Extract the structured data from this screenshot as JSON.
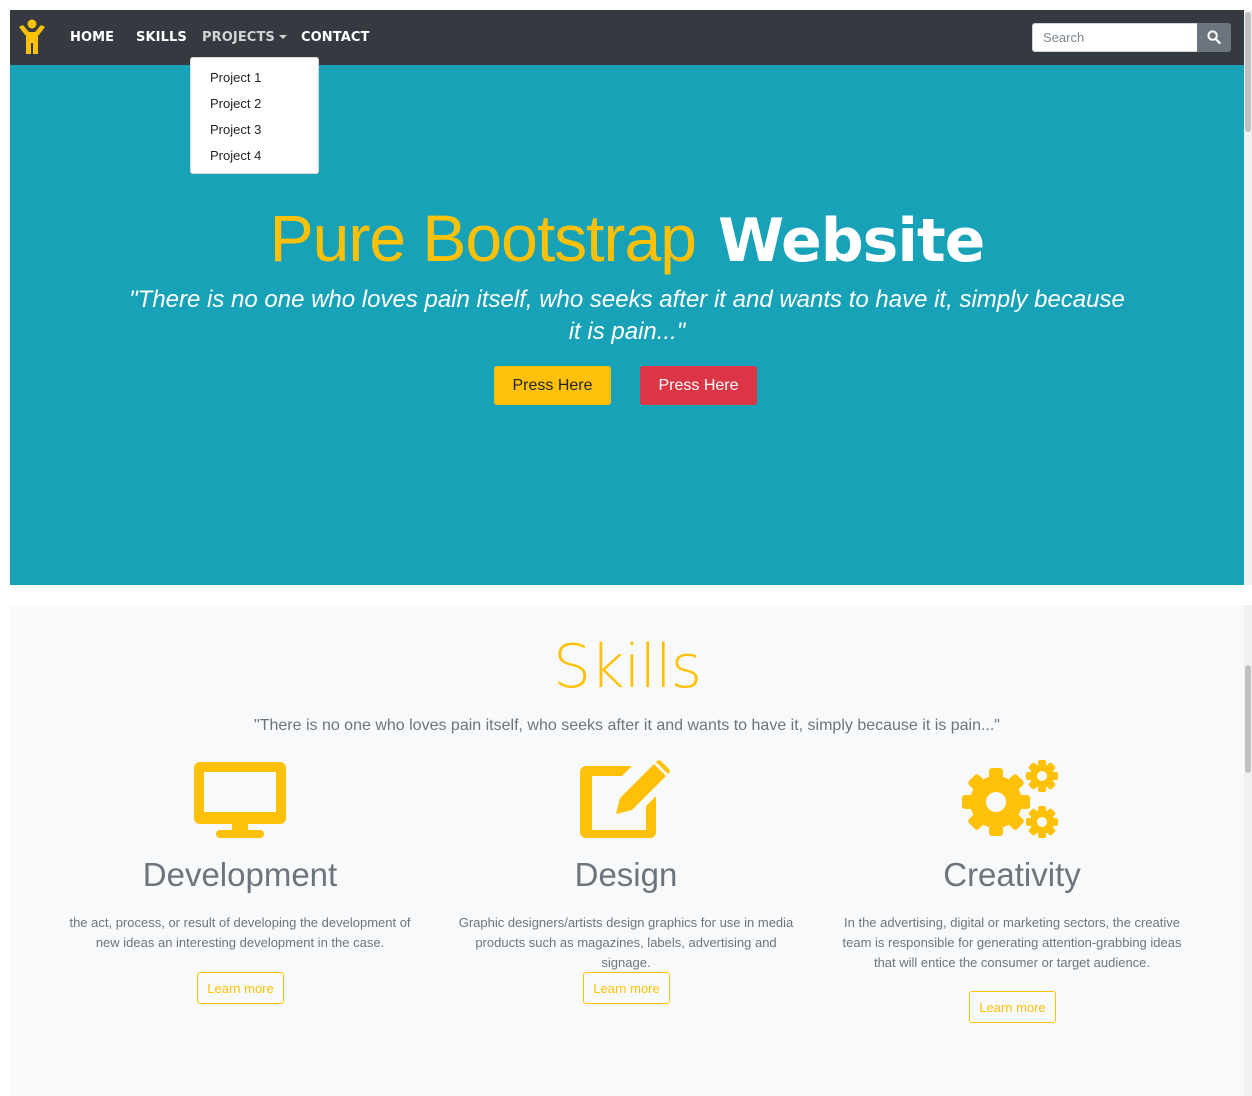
{
  "navbar": {
    "brand_icon": "person-arms-up-icon",
    "links": {
      "home": "HOME",
      "skills": "SKILLS",
      "projects": "PROJECTS",
      "contact": "CONTACT"
    },
    "search_placeholder": "Search",
    "search_icon": "search-icon"
  },
  "dropdown": {
    "items": [
      "Project 1",
      "Project 2",
      "Project 3",
      "Project 4"
    ]
  },
  "hero": {
    "title_light": "Pure Bootstrap",
    "title_bold": "Website",
    "quote": "\"There is no one who loves pain itself, who seeks after it and wants to have it, simply because it is pain...\"",
    "button_primary": "Press Here",
    "button_secondary": "Press Here"
  },
  "skills": {
    "title": "Skills",
    "quote": "\"There is no one who loves pain itself, who seeks after it and wants to have it, simply because it is pain...\"",
    "cards": [
      {
        "icon": "desktop-icon",
        "heading": "Development",
        "text": "the act, process, or result of developing the development of new ideas an interesting development in the case.",
        "button": "Learn more"
      },
      {
        "icon": "edit-icon",
        "heading": "Design",
        "text": "Graphic designers/artists design graphics for use in media products such as magazines, labels, advertising and signage.",
        "button": "Learn more"
      },
      {
        "icon": "gears-icon",
        "heading": "Creativity",
        "text": "In the advertising, digital or marketing sectors, the creative team is responsible for generating attention-grabbing ideas that will entice the consumer or target audience.",
        "button": "Learn more"
      }
    ]
  },
  "colors": {
    "hero_bg": "#17a2b8",
    "navbar_bg": "#343a40",
    "accent": "#ffc107",
    "danger": "#dc3545",
    "muted_text": "#6c757d",
    "section_bg": "#f8f9fa"
  }
}
